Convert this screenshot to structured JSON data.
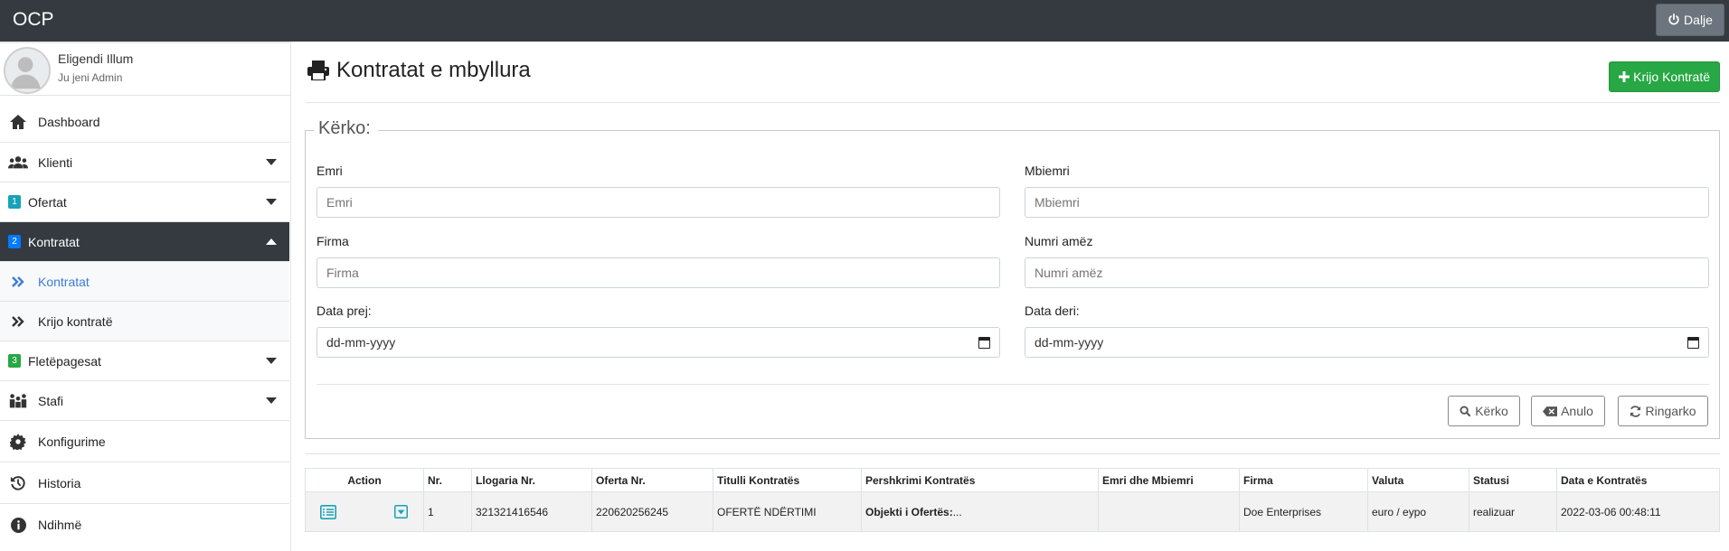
{
  "app": {
    "brand": "OCP",
    "logout_label": "Dalje"
  },
  "user": {
    "name": "Eligendi Illum",
    "role": "Ju jeni Admin"
  },
  "menu": {
    "items": [
      {
        "label": "Dashboard",
        "icon": "home-icon"
      },
      {
        "label": "Klienti",
        "icon": "users-icon"
      },
      {
        "label": "Ofertat",
        "badge": "1",
        "badge_color": "#17a2b8"
      },
      {
        "label": "Kontratat",
        "badge": "2",
        "badge_color": "#007bff"
      },
      {
        "label": "Kontratat",
        "icon": "double-chevron-icon"
      },
      {
        "label": "Krijo kontratë",
        "icon": "double-chevron-icon"
      },
      {
        "label": "Fletëpagesat",
        "badge": "3",
        "badge_color": "#28a745"
      },
      {
        "label": "Stafi",
        "icon": "staff-icon"
      },
      {
        "label": "Konfigurime",
        "icon": "gear-icon"
      },
      {
        "label": "Historia",
        "icon": "history-icon"
      },
      {
        "label": "Ndihmë",
        "icon": "info-icon"
      }
    ]
  },
  "page": {
    "title": "Kontratat e mbyllura",
    "create_label": "Krijo Kontratë"
  },
  "search": {
    "legend": "Kërko:",
    "fields": {
      "emri": {
        "label": "Emri",
        "placeholder": "Emri"
      },
      "mbiemri": {
        "label": "Mbiemri",
        "placeholder": "Mbiemri"
      },
      "firma": {
        "label": "Firma",
        "placeholder": "Firma"
      },
      "numri": {
        "label": "Numri amëz",
        "placeholder": "Numri amëz"
      },
      "data_prej": {
        "label": "Data prej:",
        "value": "dd-mm-yyyy"
      },
      "data_deri": {
        "label": "Data deri:",
        "value": "dd-mm-yyyy"
      }
    },
    "buttons": {
      "search": "Kërko",
      "cancel": "Anulo",
      "reload": "Ringarko"
    }
  },
  "table": {
    "headers": [
      "Action",
      "Nr.",
      "Llogaria Nr.",
      "Oferta Nr.",
      "Titulli Kontratës",
      "Pershkrimi Kontratës",
      "Emri dhe Mbiemri",
      "Firma",
      "Valuta",
      "Statusi",
      "Data e Kontratës"
    ],
    "rows": [
      {
        "nr": "1",
        "llogaria": "321321416546",
        "oferta": "220620256245",
        "titulli": "OFERTË NDËRTIMI",
        "pershkrimi_label": "Objekti i Ofertës:",
        "pershkrimi_more": "...",
        "emri": "",
        "firma": "Doe Enterprises",
        "valuta": "euro / eypo",
        "statusi": "realizuar",
        "data": "2022-03-06 00:48:11"
      }
    ]
  },
  "colors": {
    "topbar": "#343a40",
    "active_menu": "#343a40",
    "create_button": "#28a745",
    "link_blue": "#3c7dd8",
    "action_icon": "#17a2b8"
  }
}
